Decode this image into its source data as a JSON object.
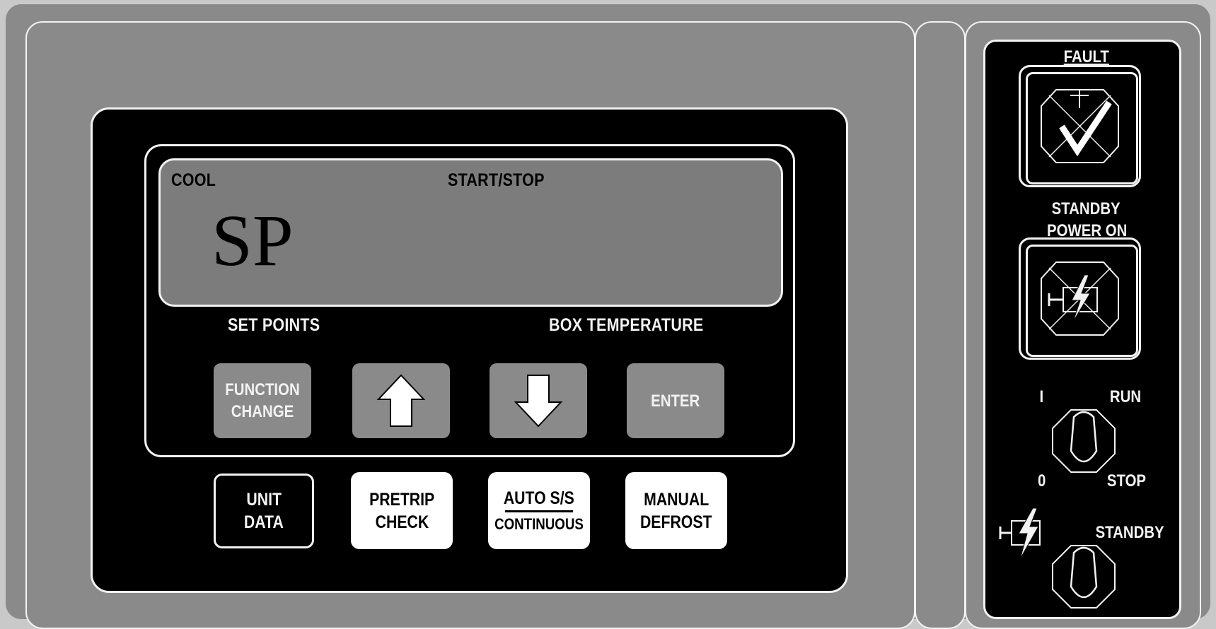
{
  "lcd": {
    "mode": "COOL",
    "status": "START/STOP",
    "code": "SP"
  },
  "labels": {
    "set_points": "SET POINTS",
    "box_temperature": "BOX TEMPERATURE"
  },
  "soft_keys": {
    "function_line1": "FUNCTION",
    "function_line2": "CHANGE",
    "up_icon": "arrow-up-icon",
    "down_icon": "arrow-down-icon",
    "enter": "ENTER"
  },
  "keys": {
    "unit_data_line1": "UNIT",
    "unit_data_line2": "DATA",
    "pretrip_line1": "PRETRIP",
    "pretrip_line2": "CHECK",
    "auto_line1": "AUTO S/S",
    "auto_line2": "CONTINUOUS",
    "manual_line1": "MANUAL",
    "manual_line2": "DEFROST"
  },
  "side": {
    "fault": "FAULT",
    "standby": "STANDBY",
    "power_on": "POWER ON",
    "run_on": "I",
    "run": "RUN",
    "run_off": "0",
    "stop": "STOP",
    "standby_switch": "STANDBY",
    "fault_icon": "checkmark-icon",
    "power_icon": "electric-motor-icon"
  },
  "colors": {
    "housing": "#8a8a8a",
    "panel": "#000000",
    "lcd": "#7c7c7c",
    "outline": "#f2f2f2"
  }
}
